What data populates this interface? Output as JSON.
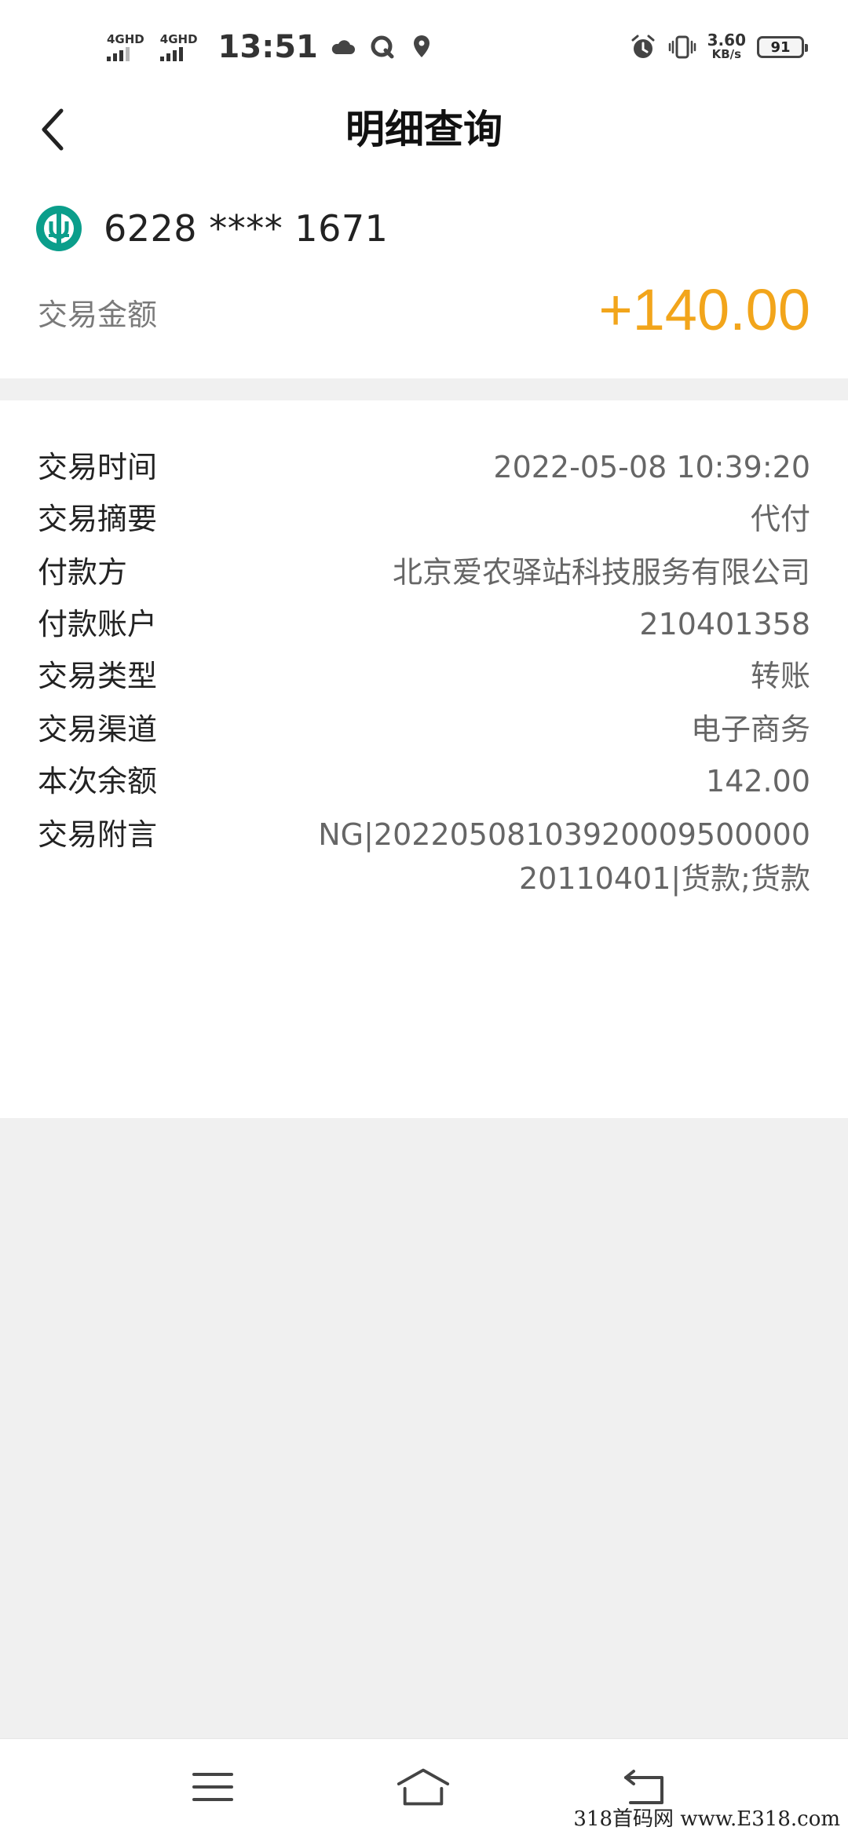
{
  "status_bar": {
    "sim1_label": "4GHD",
    "sim2_label": "4GHD",
    "time": "13:51",
    "speed_value": "3.60",
    "speed_unit": "KB/s",
    "battery": "91",
    "icons": [
      "cloud-icon",
      "q-app-icon",
      "location-pin-icon",
      "alarm-icon",
      "vibrate-icon"
    ]
  },
  "header": {
    "title": "明细查询",
    "back_icon": "chevron-left-icon"
  },
  "card": {
    "bank_icon": "abc-bank-logo-icon",
    "bank_color": "#0b9e8b",
    "number": "6228 **** 1671",
    "amount_label": "交易金额",
    "amount_value": "+140.00",
    "amount_color": "#f2a51b"
  },
  "details": [
    {
      "label": "交易时间",
      "value": "2022-05-08 10:39:20"
    },
    {
      "label": "交易摘要",
      "value": "代付"
    },
    {
      "label": "付款方",
      "value": "北京爱农驿站科技服务有限公司"
    },
    {
      "label": "付款账户",
      "value": "210401358"
    },
    {
      "label": "交易类型",
      "value": "转账"
    },
    {
      "label": "交易渠道",
      "value": "电子商务"
    },
    {
      "label": "本次余额",
      "value": "142.00"
    },
    {
      "label": "交易附言",
      "value_line1": "NG|2022050810392000950000​0",
      "value_line2": "20110401|货款;货款"
    }
  ],
  "nav_bar": {
    "icons": [
      "menu-icon",
      "home-icon",
      "back-icon"
    ]
  },
  "watermark": "318首码网 www.E318.com"
}
